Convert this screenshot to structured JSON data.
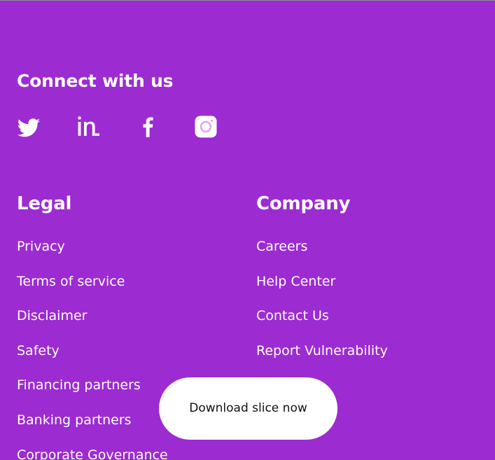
{
  "connect": {
    "heading": "Connect with us",
    "social": [
      {
        "name": "twitter-icon"
      },
      {
        "name": "linkedin-icon"
      },
      {
        "name": "facebook-icon"
      },
      {
        "name": "instagram-icon"
      }
    ]
  },
  "legal": {
    "heading": "Legal",
    "links": [
      "Privacy",
      "Terms of service",
      "Disclaimer",
      "Safety",
      "Financing partners",
      "Banking partners",
      "Corporate Governance"
    ]
  },
  "company": {
    "heading": "Company",
    "links": [
      "Careers",
      "Help Center",
      "Contact Us",
      "Report Vulnerability"
    ]
  },
  "cta": {
    "label": "Download slice now"
  },
  "colors": {
    "background": "#9c2bd1",
    "text": "#ffffff",
    "button_bg": "#ffffff",
    "button_text": "#111111"
  }
}
